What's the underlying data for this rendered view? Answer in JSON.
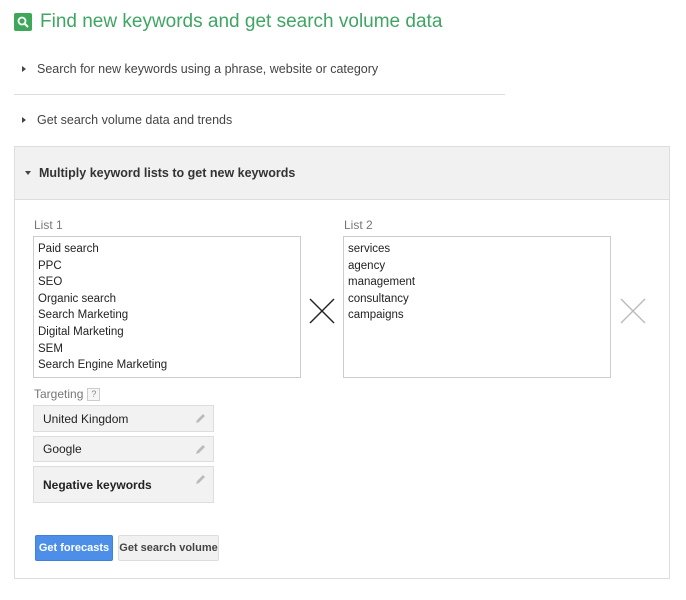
{
  "header": {
    "title": "Find new keywords and get search volume data",
    "icon": "search-icon"
  },
  "sections": [
    {
      "label": "Search for new keywords using a phrase, website or category",
      "expanded": false
    },
    {
      "label": "Get search volume data and trends",
      "expanded": false
    },
    {
      "label": "Multiply keyword lists to get new keywords",
      "expanded": true
    }
  ],
  "multiply": {
    "list1": {
      "label": "List 1",
      "items": [
        "Paid search",
        "PPC",
        "SEO",
        "Organic search",
        "Search Marketing",
        "Digital Marketing",
        "SEM",
        "Search Engine Marketing"
      ]
    },
    "list2": {
      "label": "List 2",
      "items": [
        "services",
        "agency",
        "management",
        "consultancy",
        "campaigns"
      ]
    },
    "targeting": {
      "label": "Targeting",
      "help": "?",
      "items": [
        {
          "label": "United Kingdom",
          "bold": false
        },
        {
          "label": "Google",
          "bold": false
        },
        {
          "label": "Negative keywords",
          "bold": true
        }
      ]
    },
    "buttons": {
      "forecasts": "Get forecasts",
      "search_volume": "Get search volume"
    }
  },
  "colors": {
    "accent_green": "#3fa564",
    "button_blue": "#4d8fe8"
  }
}
